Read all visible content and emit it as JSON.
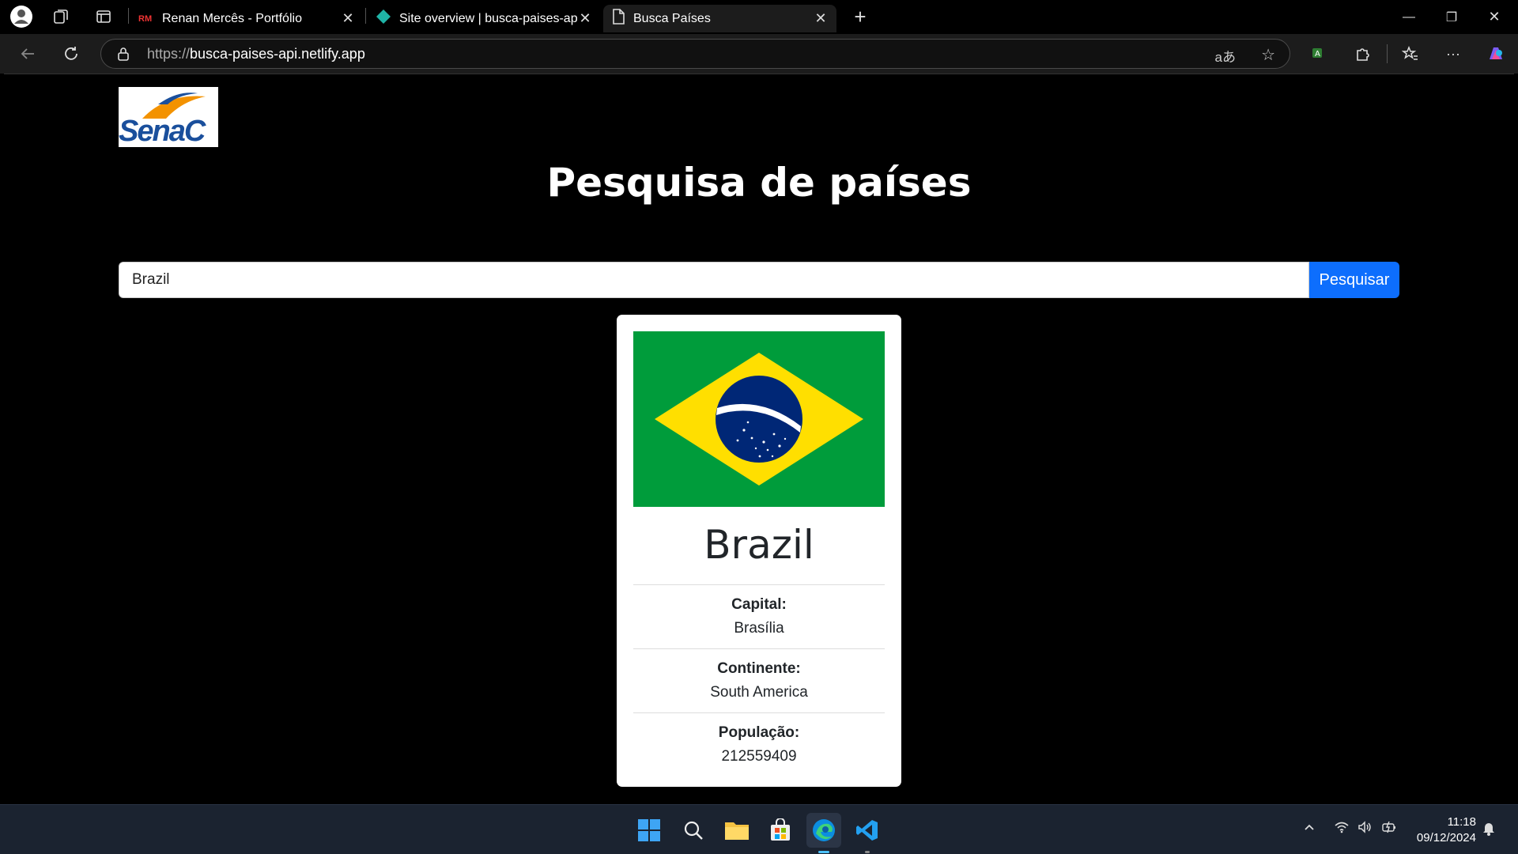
{
  "browser": {
    "tabs": [
      {
        "icon": "rm-favicon",
        "icon_text": "RM",
        "title": "Renan Mercês - Portfólio",
        "active": false
      },
      {
        "icon": "netlify-favicon",
        "title": "Site overview | busca-paises-api |",
        "active": false
      },
      {
        "icon": "page-icon",
        "title": "Busca Países",
        "active": true
      }
    ],
    "url_protocol": "https://",
    "url_host": "busca-paises-api.netlify.app"
  },
  "page": {
    "logo_text": "SenaC",
    "title": "Pesquisa de países",
    "search": {
      "value": "Brazil",
      "button_label": "Pesquisar"
    },
    "card": {
      "flag": "brazil-flag",
      "country": "Brazil",
      "fields": [
        {
          "label": "Capital:",
          "value": "Brasília"
        },
        {
          "label": "Continente:",
          "value": "South America"
        },
        {
          "label": "População:",
          "value": "212559409"
        }
      ]
    }
  },
  "taskbar": {
    "time": "11:18",
    "date": "09/12/2024"
  },
  "colors": {
    "primary_button": "#0d6efd",
    "flag_green": "#009c3b",
    "flag_yellow": "#ffdf00",
    "flag_blue": "#002776"
  }
}
